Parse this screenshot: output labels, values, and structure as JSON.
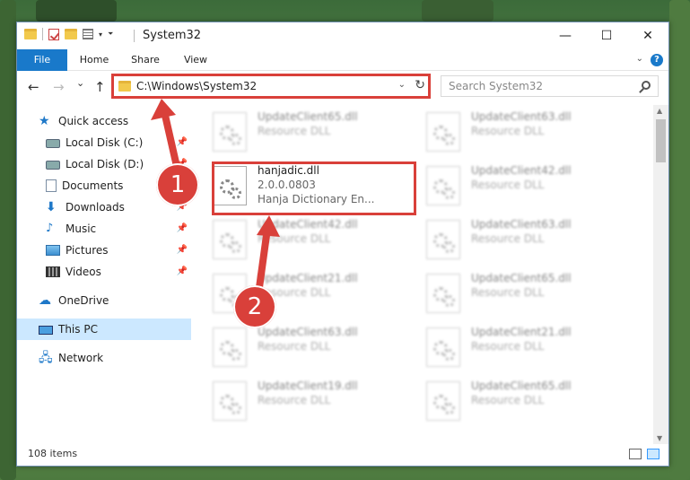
{
  "window": {
    "title": "System32",
    "minimize": "—",
    "maximize": "☐",
    "close": "✕"
  },
  "ribbon": {
    "tabs": [
      "File",
      "Home",
      "Share",
      "View"
    ],
    "help": "?"
  },
  "nav": {
    "back": "←",
    "forward": "→",
    "recent": "⌄",
    "up": "↑",
    "address": "C:\\Windows\\System32",
    "search_placeholder": "Search System32"
  },
  "sidebar": {
    "items": [
      {
        "label": "Quick access",
        "icon": "star-icon"
      },
      {
        "label": "Local Disk (C:)",
        "icon": "disk-icon",
        "pinned": true
      },
      {
        "label": "Local Disk (D:)",
        "icon": "disk-icon",
        "pinned": true
      },
      {
        "label": "Documents",
        "icon": "documents-icon",
        "pinned": true
      },
      {
        "label": "Downloads",
        "icon": "download-icon",
        "pinned": true
      },
      {
        "label": "Music",
        "icon": "music-icon",
        "pinned": true
      },
      {
        "label": "Pictures",
        "icon": "pictures-icon",
        "pinned": true
      },
      {
        "label": "Videos",
        "icon": "videos-icon",
        "pinned": true
      },
      {
        "label": "OneDrive",
        "icon": "cloud-icon"
      },
      {
        "label": "This PC",
        "icon": "pc-icon",
        "selected": true
      },
      {
        "label": "Network",
        "icon": "network-icon"
      }
    ]
  },
  "files": {
    "left": [
      {
        "name": "UpdateClient65.dll",
        "type": "Resource DLL"
      },
      {
        "name": "hanjadic.dll",
        "version": "2.0.0.0803",
        "description": "Hanja Dictionary En..."
      },
      {
        "name": "UpdateClient42.dll",
        "type": "Resource DLL"
      },
      {
        "name": "UpdateClient21.dll",
        "type": "Resource DLL"
      },
      {
        "name": "UpdateClient63.dll",
        "type": "Resource DLL"
      },
      {
        "name": "UpdateClient19.dll",
        "type": "Resource DLL"
      }
    ],
    "right": [
      {
        "name": "UpdateClient63.dll",
        "type": "Resource DLL"
      },
      {
        "name": "UpdateClient42.dll",
        "type": "Resource DLL"
      },
      {
        "name": "UpdateClient63.dll",
        "type": "Resource DLL"
      },
      {
        "name": "UpdateClient65.dll",
        "type": "Resource DLL"
      },
      {
        "name": "UpdateClient21.dll",
        "type": "Resource DLL"
      },
      {
        "name": "UpdateClient65.dll",
        "type": "Resource DLL"
      }
    ]
  },
  "status": {
    "count": "108 items"
  },
  "annotations": {
    "step1": "1",
    "step2": "2",
    "color": "#d9403a"
  },
  "colors": {
    "accent": "#1979ca",
    "selection": "#cce8ff"
  }
}
